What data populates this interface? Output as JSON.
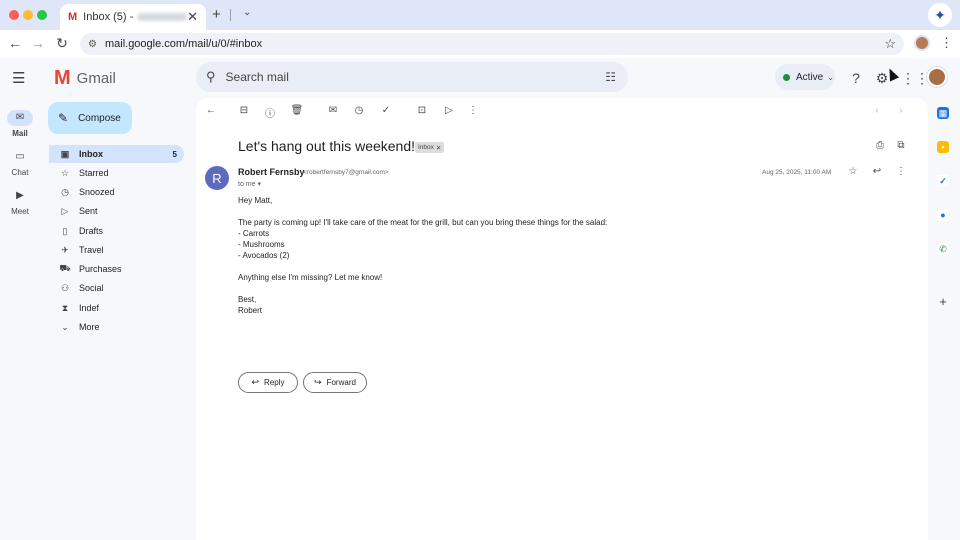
{
  "browser": {
    "tab_title": "Inbox (5) -",
    "tab_favicon": "M",
    "url": "mail.google.com/mail/u/0/#inbox",
    "icons": [
      "close-icon",
      "plus-icon",
      "chevron-down-icon",
      "back-arrow-icon",
      "forward-arrow-icon",
      "reload-icon",
      "site-settings-icon",
      "star-icon",
      "more-vert-icon",
      "gemini-icon"
    ]
  },
  "gmail": {
    "brand": "Gmail",
    "search_placeholder": "Search mail",
    "status": "Active",
    "status_color": "#1e8e3e"
  },
  "rail": [
    {
      "label": "Mail",
      "icon": "mail-icon",
      "active": true
    },
    {
      "label": "Chat",
      "icon": "chat-icon",
      "active": false
    },
    {
      "label": "Meet",
      "icon": "video-icon",
      "active": false
    }
  ],
  "sidebar": {
    "compose_label": "Compose",
    "items": [
      {
        "label": "Inbox",
        "count": "5",
        "icon": "inbox-icon"
      },
      {
        "label": "Starred",
        "icon": "star-icon"
      },
      {
        "label": "Snoozed",
        "icon": "clock-icon"
      },
      {
        "label": "Sent",
        "icon": "send-icon"
      },
      {
        "label": "Drafts",
        "icon": "draft-icon"
      },
      {
        "label": "Travel",
        "icon": "plane-icon"
      },
      {
        "label": "Purchases",
        "icon": "cart-icon"
      },
      {
        "label": "Social",
        "icon": "people-icon"
      },
      {
        "label": "Indef",
        "icon": "hourglass-icon"
      },
      {
        "label": "More",
        "icon": "chevron-down-icon"
      }
    ]
  },
  "email": {
    "subject": "Let's hang out this weekend!",
    "label_chip": "Inbox",
    "sender_initial": "R",
    "sender_name": "Robert Fernsby",
    "sender_email": "<robertfernsby7@gmail.com>",
    "recipient": "to me",
    "date": "Aug 25, 2025, 11:00 AM",
    "body": [
      "Hey Matt,",
      "The party is coming up! I'll take care of the meat for the grill, but can you bring these things for the salad:",
      "- Carrots",
      "- Mushrooms",
      "- Avocados (2)",
      "Anything else I'm missing? Let me know!",
      "Best,",
      "Robert"
    ],
    "reply_label": "Reply",
    "forward_label": "Forward"
  },
  "colors": {
    "accent": "#0b57d0",
    "compose_bg": "#c2e7ff",
    "selected_nav": "#d3e3fd",
    "avatar": "#5c6bc0"
  }
}
